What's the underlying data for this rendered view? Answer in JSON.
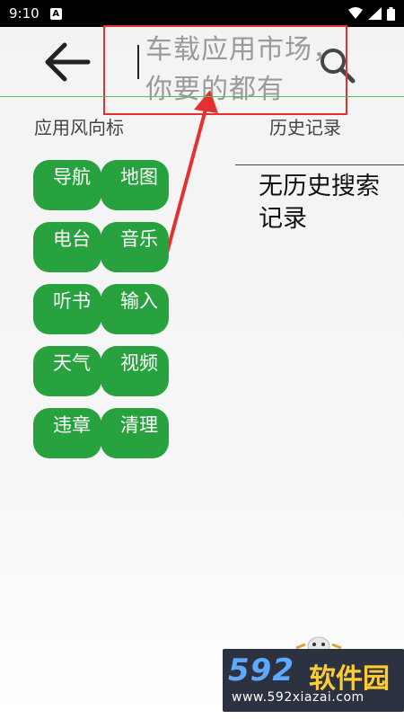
{
  "status_bar": {
    "time": "9:10",
    "notification_badge": "A"
  },
  "search": {
    "placeholder": "车载应用市场，你要的都有"
  },
  "hot": {
    "title": "应用风向标",
    "tags": [
      "导航",
      "地图",
      "电台",
      "音乐",
      "听书",
      "输入",
      "天气",
      "视频",
      "违章",
      "清理"
    ]
  },
  "history": {
    "title": "历史记录",
    "empty_text": "无历史搜索记录"
  },
  "watermark": {
    "brand": "592",
    "brand_cn": "软件园",
    "url": "www.592xiazai.com"
  },
  "colors": {
    "tag_green": "#27a23e",
    "highlight_red": "#e53030",
    "divider_green": "#5cb85c"
  }
}
